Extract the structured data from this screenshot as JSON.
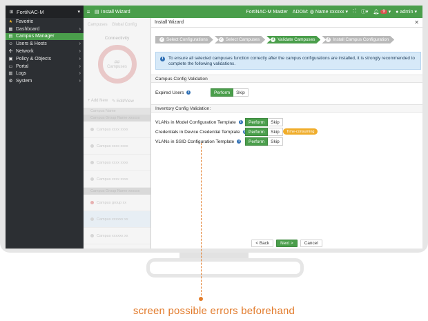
{
  "app": {
    "brand": "FortiNAC-M",
    "module_title": "Install Wizard",
    "instance": "FortiNAC-M Master",
    "adom_label": "ADOM:",
    "adom_value": "Name xxxxxx",
    "notif_count": "9",
    "user": "admin"
  },
  "sidebar": {
    "items": [
      {
        "label": "Favorite",
        "icon": "star-icon"
      },
      {
        "label": "Dashboard",
        "icon": "dashboard-icon"
      },
      {
        "label": "Campus Manager",
        "icon": "campus-icon"
      },
      {
        "label": "Users & Hosts",
        "icon": "users-icon"
      },
      {
        "label": "Network",
        "icon": "network-icon"
      },
      {
        "label": "Policy & Objects",
        "icon": "policy-icon"
      },
      {
        "label": "Portal",
        "icon": "portal-icon"
      },
      {
        "label": "Logs",
        "icon": "logs-icon"
      },
      {
        "label": "System",
        "icon": "gear-icon"
      }
    ]
  },
  "background": {
    "tab1": "Campuses",
    "tab2": "Global Config",
    "card_title": "Connectivity",
    "ring_value": "##",
    "ring_label": "Campuses",
    "add_new": "Add New",
    "edit_view": "Edit/View",
    "col_header": "Campus Name",
    "group1": "Campus Group Name xxxxxx",
    "group2": "Campus Group Name xxxxxx",
    "rows": [
      "Campus xxxx xxxx",
      "Campus xxxx xxxx",
      "Campus xxxx xxxx",
      "Campus xxxx xxxx",
      "Campus group xx",
      "Campus xxxxxx xx",
      "Campus xxxxxx xx"
    ]
  },
  "dialog": {
    "title": "Install Wizard",
    "steps": [
      {
        "num": "✓",
        "label": "Select Configurations"
      },
      {
        "num": "✓",
        "label": "Select Campuses"
      },
      {
        "num": "3",
        "label": "Validate Campuses"
      },
      {
        "num": "4",
        "label": "Install Campus Configuration"
      }
    ],
    "info": "To ensure all selected campuses function correctly after the campus configurations are installed, it is strongly recommended to complete the following validations.",
    "campus_section": "Campus Config Validation",
    "inventory_section": "Inventory Config Validation:",
    "perform_label": "Perform",
    "skip_label": "Skip",
    "rows": {
      "expired_users": "Expired Users",
      "vlans_model": "VLANs in Model Configuration Template",
      "credentials": "Credentials in Device Credential Template",
      "vlans_ssid": "VLANs in SSID Configuration Template"
    },
    "warning_badge": "Time-consuming",
    "back": "< Back",
    "next": "Next >",
    "cancel": "Cancel"
  },
  "annotation": {
    "caption": "screen possible errors beforehand"
  },
  "colors": {
    "accent_green": "#4a9e4b",
    "annotation_orange": "#e37e2c",
    "warning": "#f0ad2b"
  }
}
